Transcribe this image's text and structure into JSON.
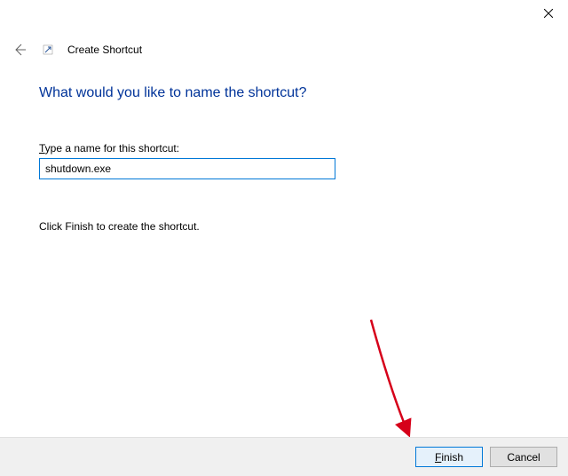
{
  "titlebar": {
    "close": "Close"
  },
  "header": {
    "back": "Back",
    "wizard_icon": "shortcut-icon",
    "wizard_title": "Create Shortcut"
  },
  "content": {
    "heading": "What would you like to name the shortcut?",
    "field_label_pre": "T",
    "field_label_rest": "ype a name for this shortcut:",
    "input_value": "shutdown.exe",
    "instruction": "Click Finish to create the shortcut."
  },
  "footer": {
    "finish_pre": "F",
    "finish_rest": "inish",
    "cancel": "Cancel"
  },
  "annotation": {
    "arrow_color": "#d6001a"
  }
}
